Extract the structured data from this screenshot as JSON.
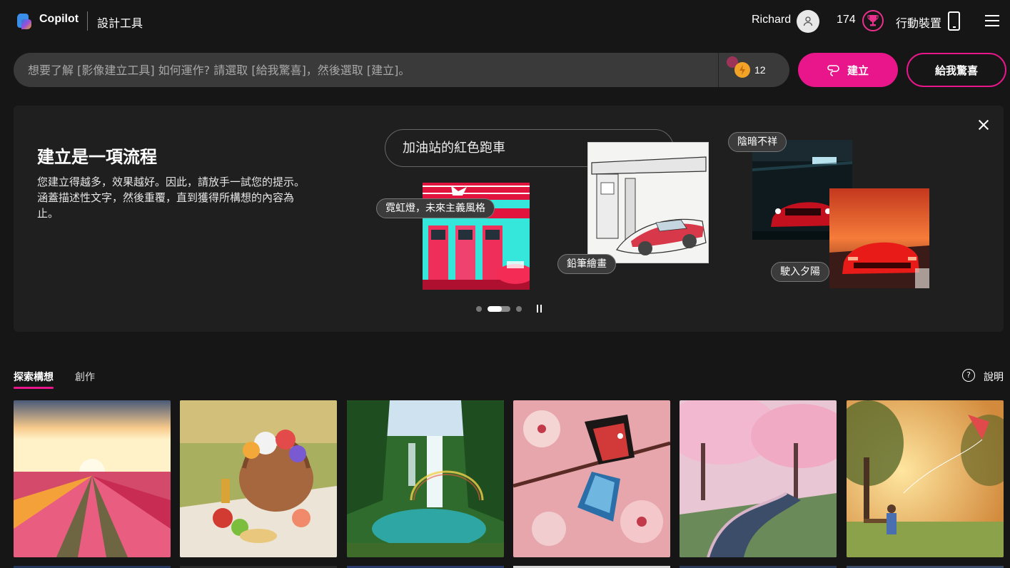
{
  "header": {
    "brand": "Copilot",
    "section": "設計工具",
    "user_name": "Richard",
    "points": "174",
    "mobile_label": "行動裝置",
    "icons": [
      "copilot-logo",
      "avatar-icon",
      "trophy-icon",
      "phone-icon",
      "menu-icon"
    ]
  },
  "prompt": {
    "placeholder": "想要了解 [影像建立工具] 如何運作? 請選取 [給我驚喜]，然後選取 [建立]。",
    "boost_count": "12",
    "create_label": "建立",
    "surprise_label": "給我驚喜"
  },
  "banner": {
    "title": "建立是一項流程",
    "description": "您建立得越多，效果越好。因此，請放手一試您的提示。涵蓋描述性文字，然後重覆，直到獲得所構想的內容為止。",
    "demo_prompt": "加油站的紅色跑車",
    "styles": [
      {
        "label": "霓虹燈，未來主義風格"
      },
      {
        "label": "鉛筆繪畫"
      },
      {
        "label": "陰暗不祥"
      },
      {
        "label": "駛入夕陽"
      }
    ]
  },
  "tabs": {
    "explore": "探索構想",
    "create": "創作",
    "help": "說明"
  },
  "colors": {
    "accent": "#e8168a",
    "background": "#161616",
    "panel": "#1f1f1f",
    "input": "#3a3a3a"
  },
  "gallery": [
    {
      "subject": "tulip-field-sunset"
    },
    {
      "subject": "picnic-basket-flowers"
    },
    {
      "subject": "waterfall-rainbow"
    },
    {
      "subject": "butterfly-cherry-blossom"
    },
    {
      "subject": "cherry-blossom-stream"
    },
    {
      "subject": "child-kite-park"
    }
  ]
}
